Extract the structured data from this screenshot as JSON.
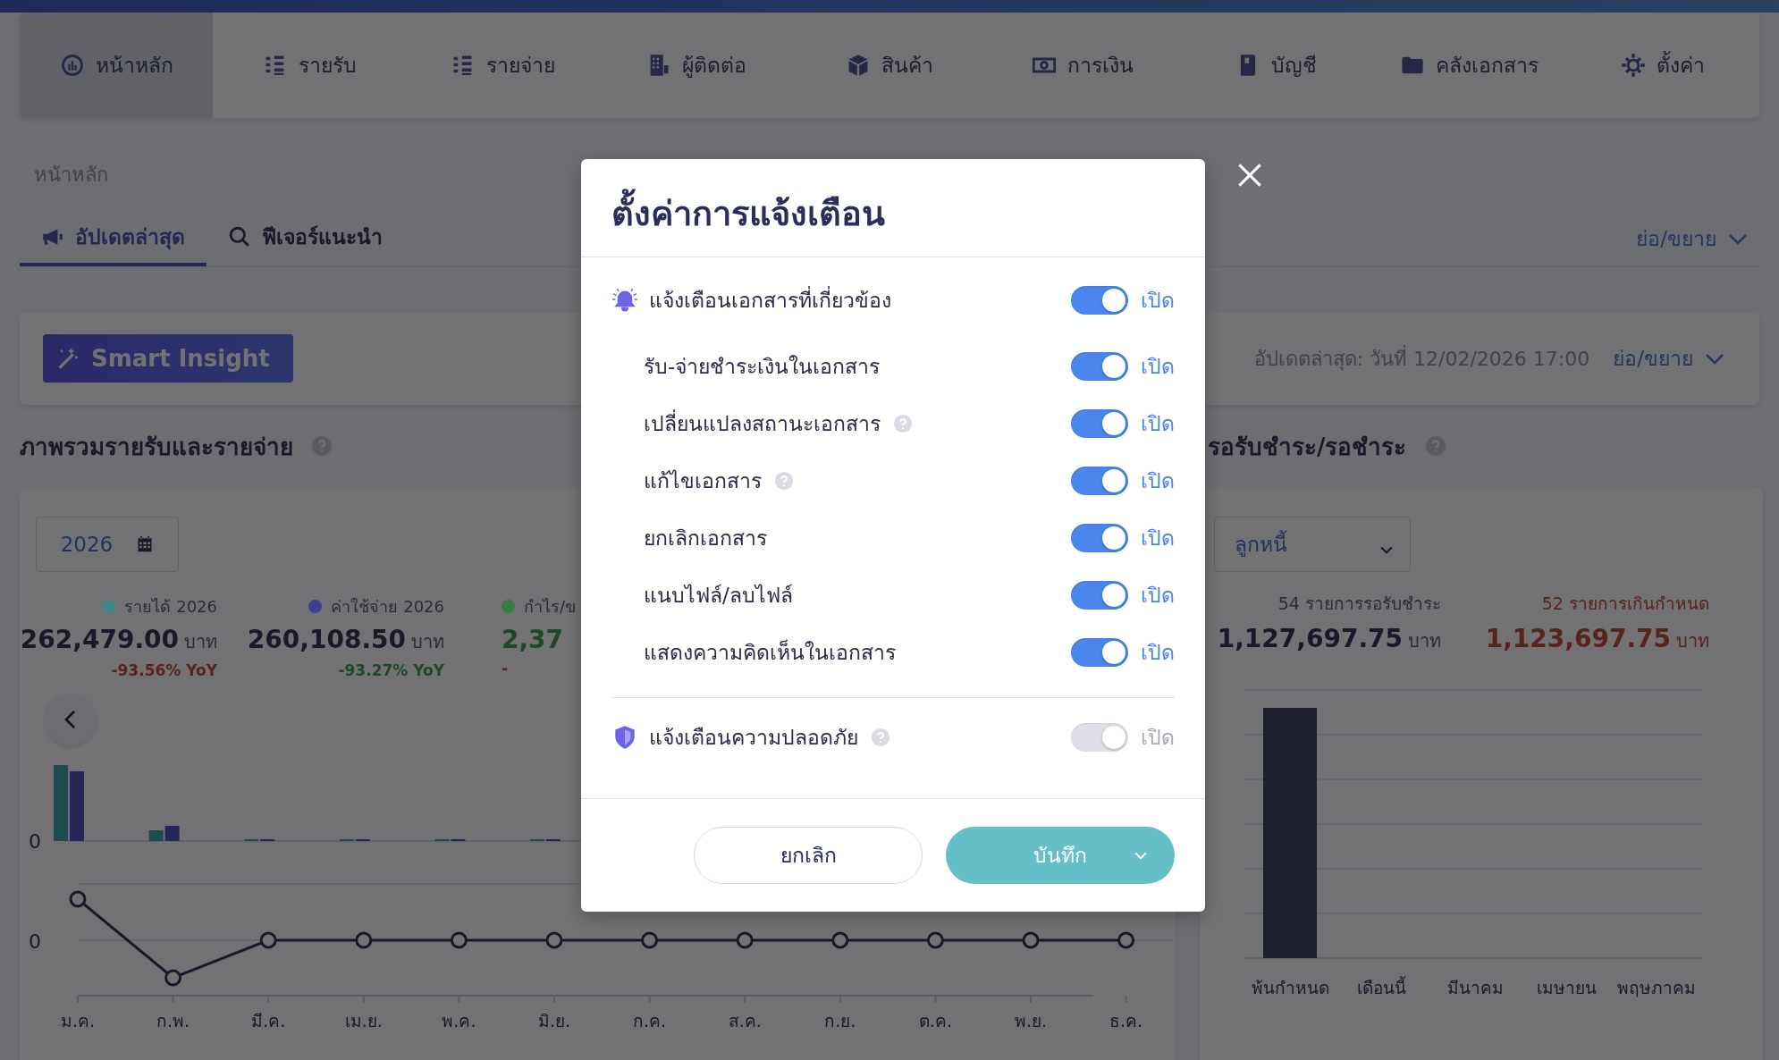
{
  "nav": {
    "items": [
      {
        "label": "หน้าหลัก",
        "selected": true
      },
      {
        "label": "รายรับ",
        "selected": false
      },
      {
        "label": "รายจ่าย",
        "selected": false
      },
      {
        "label": "ผู้ติดต่อ",
        "selected": false
      },
      {
        "label": "สินค้า",
        "selected": false
      },
      {
        "label": "การเงิน",
        "selected": false
      },
      {
        "label": "บัญชี",
        "selected": false
      },
      {
        "label": "คลังเอกสาร",
        "selected": false
      },
      {
        "label": "ตั้งค่า",
        "selected": false
      }
    ]
  },
  "breadcrumb": "หน้าหลัก",
  "tabs": [
    {
      "label": "อัปเดตล่าสุด",
      "selected": true
    },
    {
      "label": "ฟีเจอร์แนะนำ",
      "selected": false
    }
  ],
  "collapse_label": "ย่อ/ขยาย",
  "insight": {
    "button": "Smart Insight",
    "updated": "อัปเดตล่าสุด: วันที่ 12/02/2026 17:00",
    "collapse_label": "ย่อ/ขยาย"
  },
  "overview": {
    "title": "ภาพรวมรายรับและรายจ่าย",
    "year": "2026",
    "stats": [
      {
        "label": "รายได้ 2026",
        "color": "#3d8787",
        "value": "262,479.00",
        "unit": "บาท",
        "yoy": "-93.56% YoY",
        "value_highlight": false,
        "yoy_good": false
      },
      {
        "label": "ค่าใช้จ่าย 2026",
        "color": "#3f3d94",
        "value": "260,108.50",
        "unit": "บาท",
        "yoy": "-93.27% YoY",
        "value_highlight": false,
        "yoy_good": true
      },
      {
        "label": "กำไร/ข",
        "color": "#3a7b44",
        "value": "2,37",
        "yoy": "-",
        "value_highlight": true,
        "yoy_good": false
      }
    ],
    "bar_zero": "0",
    "line_zero": "0",
    "months": [
      "ม.ค.",
      "ก.พ.",
      "มี.ค.",
      "เม.ย.",
      "พ.ค.",
      "มิ.ย.",
      "ก.ค.",
      "ส.ค.",
      "ก.ย.",
      "ต.ค.",
      "พ.ย.",
      "ธ.ค."
    ]
  },
  "receivables": {
    "title": "รอรับชำระ/รอชำระ",
    "filter": "ลูกหนี้",
    "stats": [
      {
        "label": "54 รายการรอรับชำระ",
        "value": "1,127,697.75",
        "unit": "บาท",
        "overdue": false
      },
      {
        "label": "52 รายการเกินกำหนด",
        "value": "1,123,697.75",
        "unit": "บาท",
        "overdue": true
      }
    ],
    "categories": [
      "พ้นกำหนด",
      "เดือนนี้",
      "มีนาคม",
      "เมษายน",
      "พฤษภาคม"
    ]
  },
  "dialog": {
    "title": "ตั้งค่าการแจ้งเตือน",
    "rows": [
      {
        "kind": "notify",
        "label": "แจ้งเตือนเอกสารที่เกี่ยวข้อง",
        "help": false,
        "on": true,
        "disabled": false,
        "state_label": "เปิด"
      },
      {
        "kind": "option",
        "label": "รับ-จ่ายชำระเงินในเอกสาร",
        "help": false,
        "on": true,
        "disabled": false,
        "state_label": "เปิด"
      },
      {
        "kind": "option",
        "label": "เปลี่ยนแปลงสถานะเอกสาร",
        "help": true,
        "on": true,
        "disabled": false,
        "state_label": "เปิด"
      },
      {
        "kind": "option",
        "label": "แก้ไขเอกสาร",
        "help": true,
        "on": true,
        "disabled": false,
        "state_label": "เปิด"
      },
      {
        "kind": "option",
        "label": "ยกเลิกเอกสาร",
        "help": false,
        "on": true,
        "disabled": false,
        "state_label": "เปิด"
      },
      {
        "kind": "option",
        "label": "แนบไฟล์/ลบไฟล์",
        "help": false,
        "on": true,
        "disabled": false,
        "state_label": "เปิด"
      },
      {
        "kind": "option",
        "label": "แสดงความคิดเห็นในเอกสาร",
        "help": false,
        "on": true,
        "disabled": false,
        "state_label": "เปิด"
      },
      {
        "kind": "security",
        "label": "แจ้งเตือนความปลอดภัย",
        "help": true,
        "on": true,
        "disabled": true,
        "state_label": "เปิด"
      }
    ],
    "cancel": "ยกเลิก",
    "save": "บันทึก"
  }
}
